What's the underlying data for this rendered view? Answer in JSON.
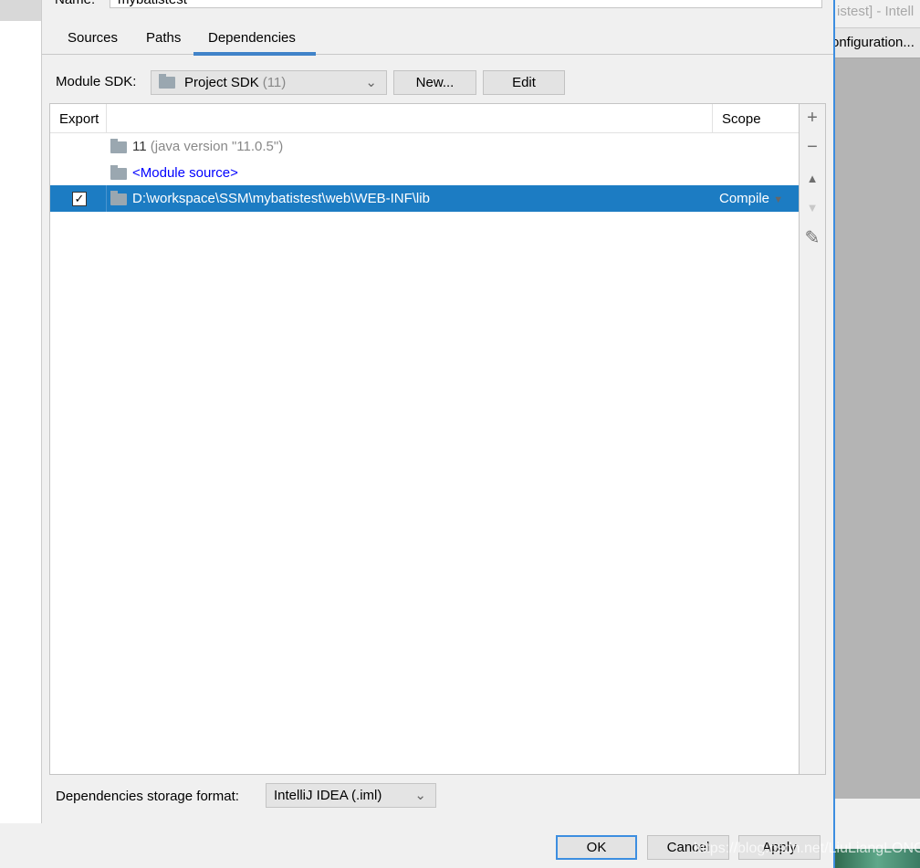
{
  "name_field": {
    "label": "Name:",
    "value": "mybatistest"
  },
  "tabs": [
    {
      "label": "Sources"
    },
    {
      "label": "Paths"
    },
    {
      "label": "Dependencies",
      "selected": true
    }
  ],
  "sdk": {
    "label": "Module SDK:",
    "value": "Project SDK",
    "value_hint": "(11)",
    "new_label": "New...",
    "edit_label": "Edit"
  },
  "table": {
    "headers": {
      "export": "Export",
      "scope": "Scope"
    },
    "rows": [
      {
        "name": "11",
        "detail": "(java version \"11.0.5\")",
        "icon": "jdk-folder-icon"
      },
      {
        "name": "<Module source>",
        "icon": "module-source-folder-icon",
        "color": "#0000ff"
      },
      {
        "name": "D:\\workspace\\SSM\\mybatistest\\web\\WEB-INF\\lib",
        "icon": "folder-icon",
        "export": true,
        "scope": "Compile",
        "selected": true
      }
    ]
  },
  "toolbar": {
    "add": "+",
    "remove": "−",
    "up": "▲",
    "down": "▼",
    "edit": "✎"
  },
  "storage": {
    "label": "Dependencies storage format:",
    "value": "IntelliJ IDEA (.iml)"
  },
  "buttons": {
    "ok": "OK",
    "cancel": "Cancel",
    "apply": "Apply"
  },
  "background_window": {
    "title": "istest] - Intell",
    "config": "onfiguration..."
  },
  "watermark": "https://blog.csdn.net/LiuLiangLONG",
  "colors": {
    "selection": "#1c7cc3",
    "tab_underline": "#4083c9",
    "link": "#0000ff"
  }
}
